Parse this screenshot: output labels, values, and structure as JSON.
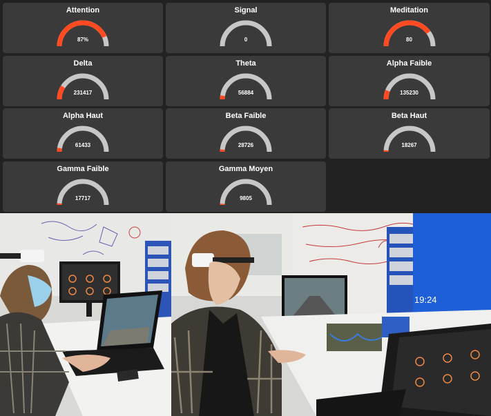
{
  "colors": {
    "accent": "#ff4a22",
    "track": "#c7c7c7",
    "card": "#3a3a3a",
    "bg": "#222222"
  },
  "gauges": [
    {
      "title": "Attention",
      "value": "87%",
      "level": 0.87
    },
    {
      "title": "Signal",
      "value": "0",
      "level": 0.0
    },
    {
      "title": "Meditation",
      "value": "80",
      "level": 0.8
    },
    {
      "title": "Delta",
      "value": "231417",
      "level": 0.18
    },
    {
      "title": "Theta",
      "value": "56884",
      "level": 0.05
    },
    {
      "title": "Alpha Faible",
      "value": "135230",
      "level": 0.12
    },
    {
      "title": "Alpha Haut",
      "value": "61433",
      "level": 0.05
    },
    {
      "title": "Beta Faible",
      "value": "28726",
      "level": 0.03
    },
    {
      "title": "Beta Haut",
      "value": "18267",
      "level": 0.02
    },
    {
      "title": "Gamma Faible",
      "value": "17717",
      "level": 0.02
    },
    {
      "title": "Gamma Moyen",
      "value": "9805",
      "level": 0.01
    }
  ],
  "photo_left": {
    "clock": ""
  },
  "photo_right": {
    "clock": "19:24"
  }
}
